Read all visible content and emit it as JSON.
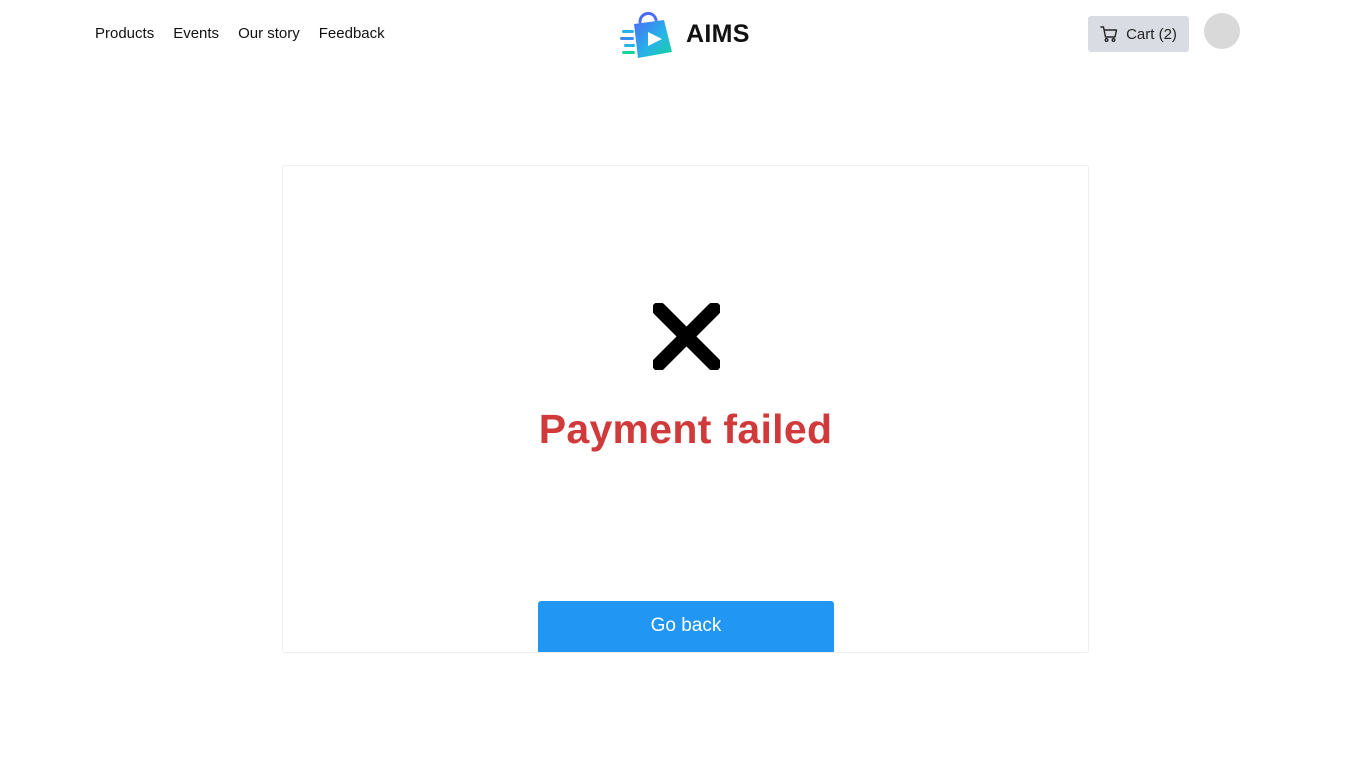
{
  "header": {
    "nav": [
      {
        "label": "Products"
      },
      {
        "label": "Events"
      },
      {
        "label": "Our story"
      },
      {
        "label": "Feedback"
      }
    ],
    "brand_name": "AIMS",
    "cart_label": "Cart (2)",
    "cart_icon": "cart-icon",
    "avatar_color": "#d9d9d9"
  },
  "result": {
    "icon": "close-icon",
    "title": "Payment failed",
    "title_color": "#d03a3a",
    "go_back_label": "Go back",
    "button_color": "#2196f3"
  }
}
